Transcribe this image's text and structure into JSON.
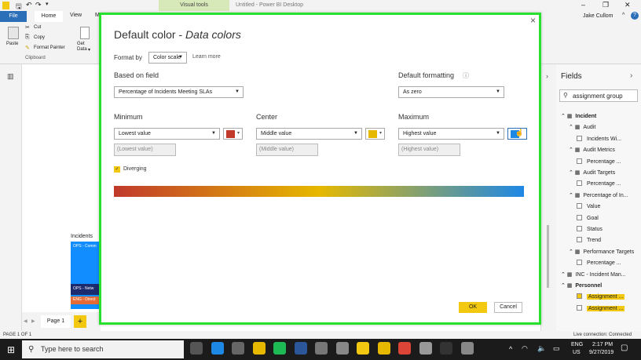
{
  "app": {
    "window_title": "Untitled - Power BI Desktop",
    "user": "Jake Cullom",
    "contextual_tab": "Visual tools"
  },
  "ribbon": {
    "tabs": [
      "File",
      "Home",
      "View",
      "M"
    ],
    "clipboard": {
      "paste": "Paste",
      "cut": "Cut",
      "copy": "Copy",
      "format_painter": "Format Painter",
      "group_label": "Clipboard"
    },
    "get_data": "Get Data",
    "get_data_caret": "▾"
  },
  "canvas": {
    "visual_title": "Incidents",
    "rows": [
      "OPS - Comm",
      "OPS - Netw",
      "ENG - Direct"
    ]
  },
  "page_tab": {
    "label": "Page 1",
    "add": "+"
  },
  "status_bar": {
    "page": "PAGE 1 OF 1",
    "connection": "Live connection: Connected"
  },
  "fields_pane": {
    "title": "Fields",
    "search_value": "assignment group",
    "items": [
      {
        "label": "Incident",
        "level": 0,
        "bold": true
      },
      {
        "label": "Audit",
        "level": 1
      },
      {
        "label": "Incidents Wi...",
        "level": 2
      },
      {
        "label": "Audit Metrics",
        "level": 1
      },
      {
        "label": "Percentage ...",
        "level": 2
      },
      {
        "label": "Audit Targets",
        "level": 1
      },
      {
        "label": "Percentage ...",
        "level": 2
      },
      {
        "label": "Percentage of In...",
        "level": 1
      },
      {
        "label": "Value",
        "level": 2
      },
      {
        "label": "Goal",
        "level": 2
      },
      {
        "label": "Status",
        "level": 2
      },
      {
        "label": "Trend",
        "level": 2
      },
      {
        "label": "Performance Targets",
        "level": 1
      },
      {
        "label": "Percentage ...",
        "level": 2
      },
      {
        "label": "INC - Incident Man...",
        "level": 0
      },
      {
        "label": "Personnel",
        "level": 0,
        "bold": true
      },
      {
        "label": "Assignment ...",
        "level": 2,
        "checked": true,
        "highlight": true
      },
      {
        "label": "Assignment ...",
        "level": 2,
        "highlight": true
      }
    ]
  },
  "dialog": {
    "title_main": "Default color - ",
    "title_sub": "Data colors",
    "format_by_label": "Format by",
    "format_by_value": "Color scale",
    "learn_more": "Learn more",
    "based_on_label": "Based on field",
    "based_on_value": "Percentage of Incidents Meeting SLAs",
    "default_formatting_label": "Default formatting",
    "default_formatting_value": "As zero",
    "minimum": {
      "label": "Minimum",
      "value": "Lowest value",
      "input_placeholder": "(Lowest value)",
      "color": "#c0392b"
    },
    "center": {
      "label": "Center",
      "value": "Middle value",
      "input_placeholder": "(Middle value)",
      "color": "#e6b800"
    },
    "maximum": {
      "label": "Maximum",
      "value": "Highest value",
      "input_placeholder": "(Highest value)",
      "color": "#1e88e5"
    },
    "diverging_label": "Diverging",
    "ok": "OK",
    "cancel": "Cancel",
    "close": "×"
  },
  "taskbar": {
    "search_placeholder": "Type here to search",
    "lang": "ENG",
    "region": "US",
    "time": "2:17 PM",
    "date": "9/27/2019"
  },
  "colors": {
    "accent": "#2b6fb8",
    "dialog_border": "#28e02e",
    "ok_button": "#f2c811",
    "highlight": "#f2c811"
  }
}
